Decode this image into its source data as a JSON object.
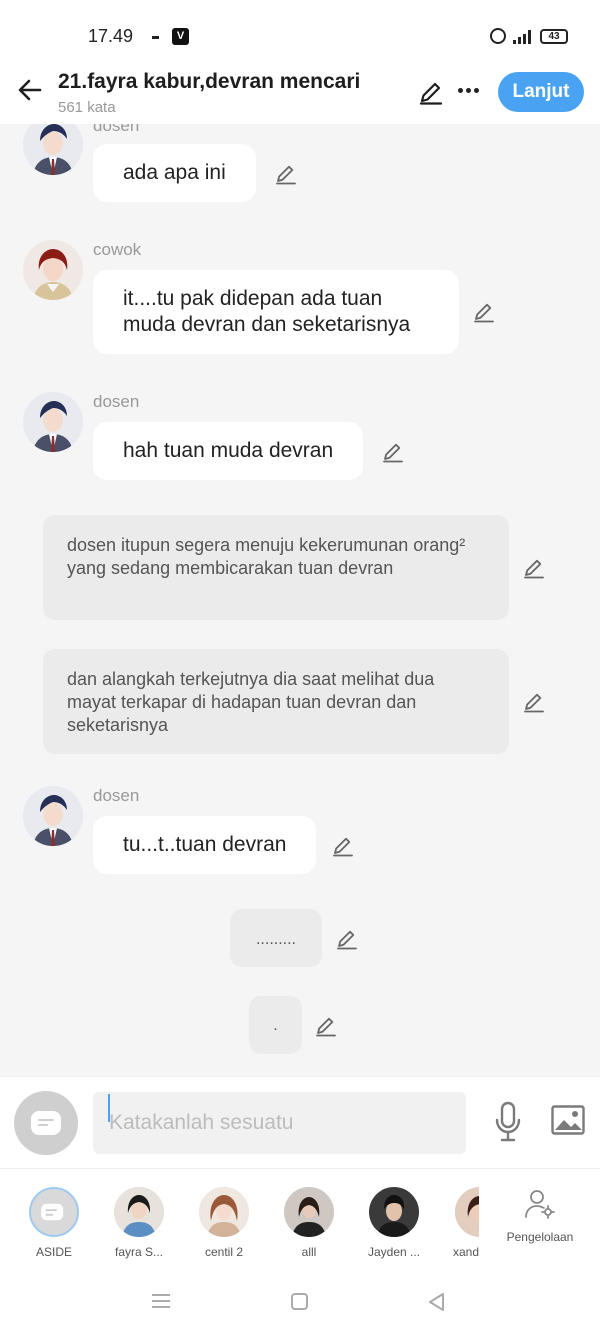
{
  "status_bar": {
    "time": "17.49",
    "app_badge": "V",
    "battery": "43"
  },
  "header": {
    "title": "21.fayra kabur,devran mencari",
    "word_count": "561 kata",
    "next_button": "Lanjut"
  },
  "messages": [
    {
      "type": "character",
      "speaker": "dosen",
      "text": "ada apa ini"
    },
    {
      "type": "character",
      "speaker": "cowok",
      "text": "it....tu pak didepan ada tuan muda devran dan seketarisnya"
    },
    {
      "type": "character",
      "speaker": "dosen",
      "text": "hah tuan muda devran"
    },
    {
      "type": "narration",
      "text": "dosen itupun segera menuju kekerumunan orang² yang sedang membicarakan tuan devran"
    },
    {
      "type": "narration",
      "text": "dan alangkah terkejutnya dia saat melihat dua mayat terkapar di hadapan tuan devran dan seketarisnya"
    },
    {
      "type": "character",
      "speaker": "dosen",
      "text": "tu...t..tuan devran"
    },
    {
      "type": "narration",
      "text": "........."
    },
    {
      "type": "narration",
      "text": "."
    }
  ],
  "input": {
    "placeholder": "Katakanlah sesuatu"
  },
  "characters": [
    {
      "label": "ASIDE",
      "selected": true
    },
    {
      "label": "fayra S..."
    },
    {
      "label": "centil 2"
    },
    {
      "label": "alll"
    },
    {
      "label": "Jayden ..."
    },
    {
      "label": "xand"
    }
  ],
  "manage_label": "Pengelolaan",
  "colors": {
    "accent": "#4aa3f2",
    "bubble": "#ffffff",
    "narration": "#ebebeb",
    "background": "#f5f5f5"
  }
}
